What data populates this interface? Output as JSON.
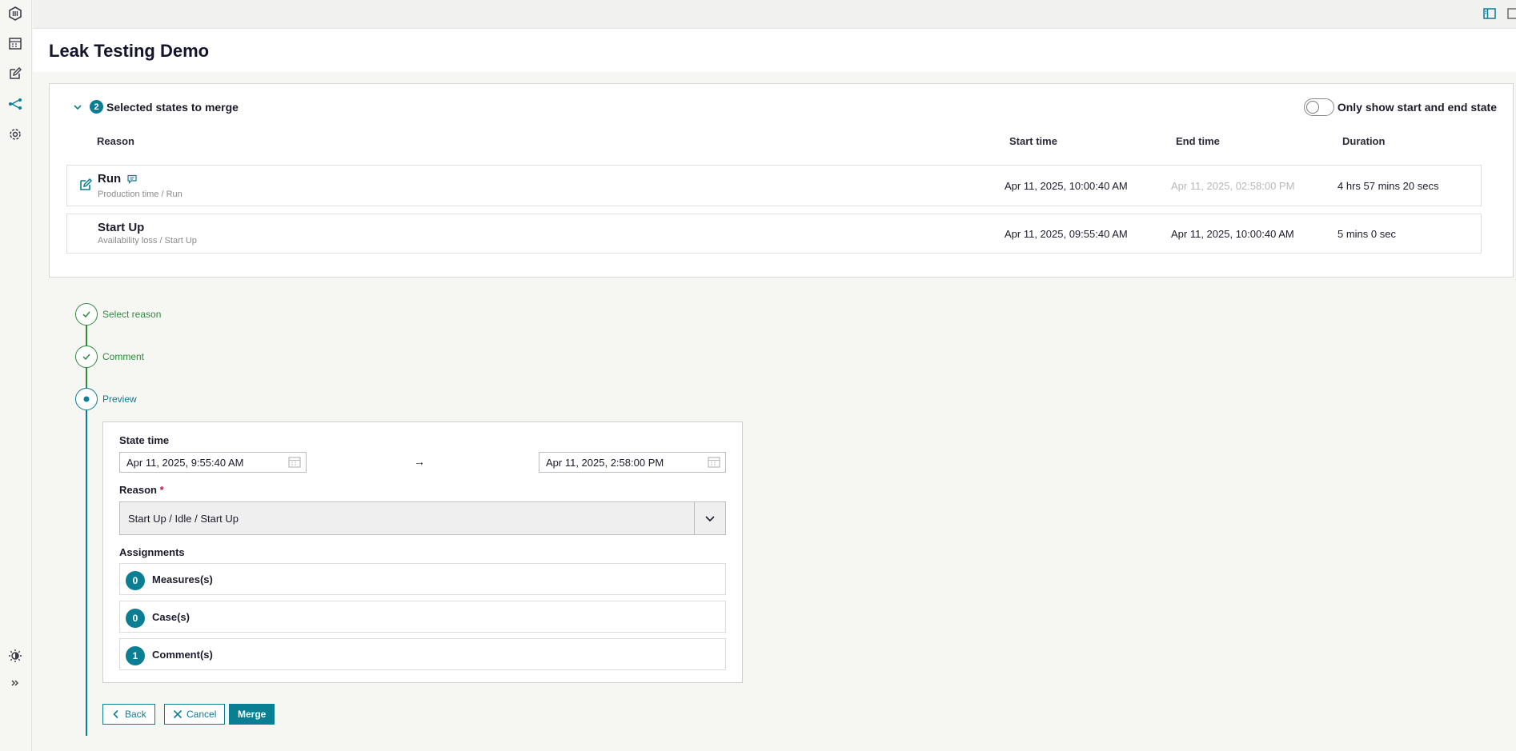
{
  "page": {
    "title": "Leak Testing Demo"
  },
  "sidebar": {
    "items": [
      {
        "name": "logo",
        "icon": "hexagon-logo-icon"
      },
      {
        "name": "calendar",
        "icon": "calendar-icon"
      },
      {
        "name": "edit",
        "icon": "edit-icon"
      },
      {
        "name": "merge",
        "icon": "merge-icon",
        "active": true
      },
      {
        "name": "settings",
        "icon": "gear-icon"
      },
      {
        "name": "theme",
        "icon": "sun-icon"
      },
      {
        "name": "expand",
        "icon": "double-chevron-right-icon"
      }
    ]
  },
  "merge_panel": {
    "count": "2",
    "title": "Selected states to merge",
    "toggle_label": "Only show start and end state",
    "toggle_on": false,
    "columns": {
      "reason": "Reason",
      "start": "Start time",
      "end": "End time",
      "duration": "Duration"
    },
    "rows": [
      {
        "name": "Run",
        "category": "Production time / Run",
        "start": "Apr 11, 2025, 10:00:40 AM",
        "end": "Apr 11, 2025, 02:58:00 PM",
        "duration": "4 hrs 57 mins 20 secs",
        "editable": true,
        "has_comment": true
      },
      {
        "name": "Start Up",
        "category": "Availability loss / Start Up",
        "start": "Apr 11, 2025, 09:55:40 AM",
        "end": "Apr 11, 2025, 10:00:40 AM",
        "duration": "5 mins 0 sec",
        "editable": false,
        "has_comment": false
      }
    ]
  },
  "steps": [
    {
      "label": "Select reason",
      "status": "done"
    },
    {
      "label": "Comment",
      "status": "done"
    },
    {
      "label": "Preview",
      "status": "current"
    }
  ],
  "preview": {
    "state_time_label": "State time",
    "start_value": "Apr 11, 2025, 9:55:40 AM",
    "end_value": "Apr 11, 2025, 2:58:00 PM",
    "arrow": "→",
    "reason_label": "Reason",
    "required_mark": "*",
    "reason_value": "Start Up / Idle / Start Up",
    "assignments_label": "Assignments",
    "assignments": [
      {
        "count": "0",
        "label": "Measures(s)"
      },
      {
        "count": "0",
        "label": "Case(s)"
      },
      {
        "count": "1",
        "label": "Comment(s)"
      }
    ]
  },
  "actions": {
    "back": "Back",
    "cancel": "Cancel",
    "merge": "Merge"
  },
  "colors": {
    "accent": "#0a7e93",
    "success": "#2e8b3e"
  }
}
